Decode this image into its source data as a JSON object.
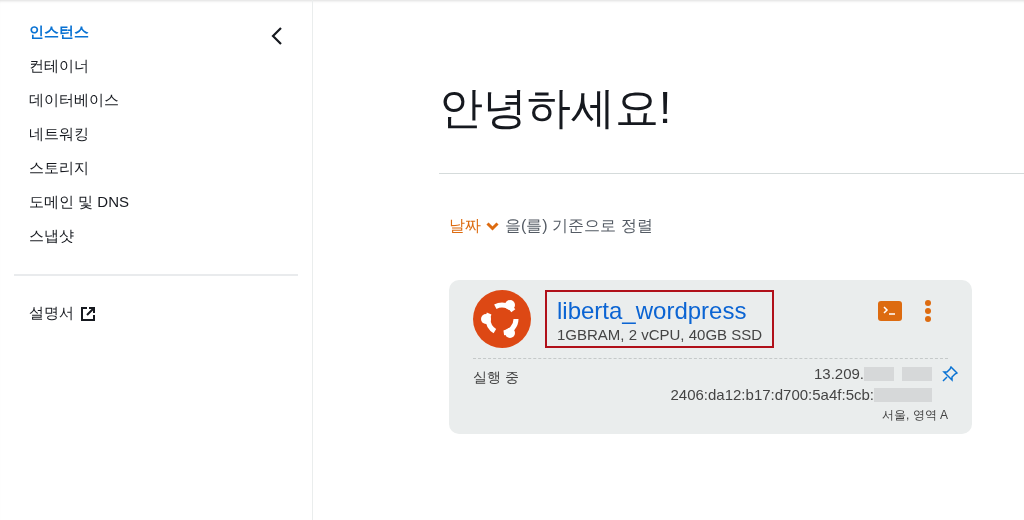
{
  "sidebar": {
    "items": [
      {
        "label": "인스턴스",
        "selected": true
      },
      {
        "label": "컨테이너",
        "selected": false
      },
      {
        "label": "데이터베이스",
        "selected": false
      },
      {
        "label": "네트워킹",
        "selected": false
      },
      {
        "label": "스토리지",
        "selected": false
      },
      {
        "label": "도메인 및 DNS",
        "selected": false
      },
      {
        "label": "스냅샷",
        "selected": false
      }
    ],
    "docs_link": "설명서"
  },
  "heading": "안녕하세요!",
  "sort": {
    "field": "날짜",
    "suffix": "을(를) 기준으로 정렬"
  },
  "instances": [
    {
      "name": "liberta_wordpress",
      "specs": "1GBRAM, 2 vCPU, 40GB SSD",
      "highlighted": true,
      "status": "실행 중",
      "ipv4": "13.209.",
      "ipv6": "2406:da12:b17:d700:5a4f:5cb:",
      "ipv4_redacted": true,
      "ipv6_redacted": true,
      "location": "서울, 영역 A"
    }
  ]
}
